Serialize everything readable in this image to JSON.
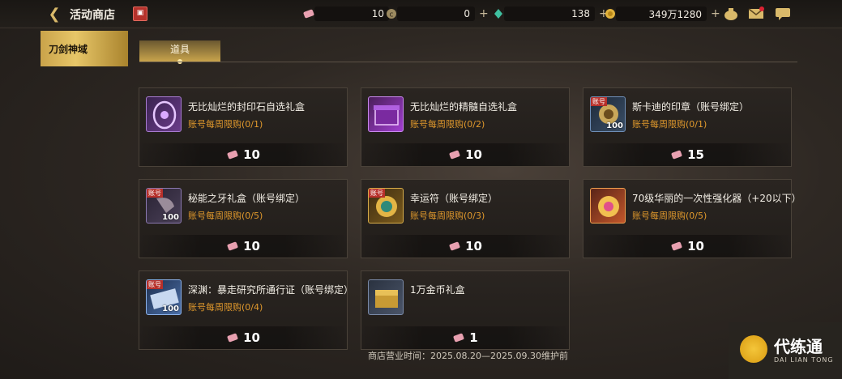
{
  "header": {
    "title": "活动商店",
    "currencies": [
      {
        "icon": "pink-ticket-icon",
        "value": "10"
      },
      {
        "icon": "c-coin-icon",
        "value": "0"
      },
      {
        "icon": "green-crystal-icon",
        "value": "138"
      },
      {
        "icon": "gold-coin-icon",
        "value": "349万1280"
      }
    ]
  },
  "sidebar": {
    "items": [
      {
        "label": "刀剑神域"
      }
    ]
  },
  "tabs": [
    {
      "label": "道具"
    }
  ],
  "items": [
    {
      "name": "无比灿烂的封印石自选礼盒",
      "limit": "账号每周限购(0/1)",
      "price": "10",
      "qty": "",
      "bound": false,
      "icon": "seal-stone-box-icon"
    },
    {
      "name": "无比灿烂的精髓自选礼盒",
      "limit": "账号每周限购(0/2)",
      "price": "10",
      "qty": "",
      "bound": false,
      "icon": "essence-box-icon"
    },
    {
      "name": "斯卡迪的印章（账号绑定）",
      "limit": "账号每周限购(0/1)",
      "price": "15",
      "qty": "100",
      "bound": true,
      "icon": "skadi-seal-icon"
    },
    {
      "name": "秘能之牙礼盒（账号绑定）",
      "limit": "账号每周限购(0/5)",
      "price": "10",
      "qty": "100",
      "bound": true,
      "icon": "fang-box-icon"
    },
    {
      "name": "幸运符（账号绑定）",
      "limit": "账号每周限购(0/3)",
      "price": "10",
      "qty": "",
      "bound": true,
      "icon": "lucky-charm-icon"
    },
    {
      "name": "70级华丽的一次性强化器（+20以下）",
      "limit": "账号每周限购(0/5)",
      "price": "10",
      "qty": "",
      "bound": false,
      "icon": "enhancer-icon"
    },
    {
      "name": "深渊：暴走研究所通行证（账号绑定）",
      "limit": "账号每周限购(0/4)",
      "price": "10",
      "qty": "100",
      "bound": true,
      "icon": "pass-ticket-icon"
    },
    {
      "name": "1万金币礼盒",
      "limit": "",
      "price": "1",
      "qty": "",
      "bound": false,
      "icon": "gold-chest-icon"
    }
  ],
  "bind_badge": "账号",
  "footer": {
    "hours": "商店营业时间：2025.08.20—2025.09.30维护前"
  },
  "watermark": {
    "title": "代练通",
    "subtitle": "DAI LIAN TONG"
  },
  "colors": {
    "accent": "#d9b96a",
    "limit": "#e0992c",
    "tab_gold": "#e7c668"
  }
}
